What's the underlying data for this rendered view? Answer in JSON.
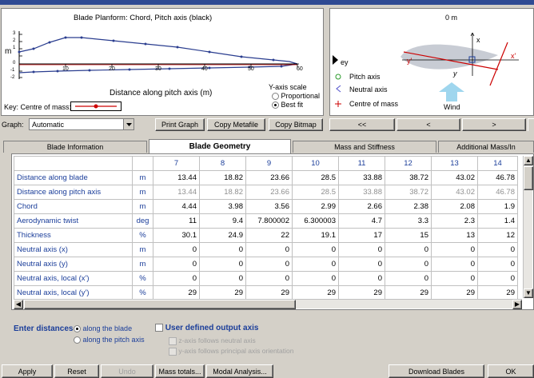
{
  "planform": {
    "title": "Blade Planform: Chord, Pitch axis (black)",
    "y_unit": "m",
    "x_label": "Distance along pitch axis (m)",
    "x_ticks": [
      "10",
      "20",
      "30",
      "40",
      "50",
      "60"
    ],
    "y_ticks": [
      "3",
      "2",
      "1",
      "0",
      "-1",
      "-2"
    ],
    "key_label": "Key:  Centre of mass:",
    "yscale_title": "Y-axis scale",
    "yscale_opt1": "Proportional",
    "yscale_opt2": "Best fit"
  },
  "section_view": {
    "top_label": "0 m",
    "ey_label": "ey",
    "pitch_axis": "Pitch axis",
    "neutral_axis": "Neutral axis",
    "centre_of_mass": "Centre of mass",
    "wind": "Wind",
    "x_label": "x",
    "y_label": "y",
    "xp_label": "x'",
    "yp_label": "y'"
  },
  "toolbar": {
    "graph_label": "Graph:",
    "graph_value": "Automatic",
    "print_graph": "Print Graph",
    "copy_metafile": "Copy Metafile",
    "copy_bitmap": "Copy Bitmap",
    "nav_first": "<<",
    "nav_prev": "<",
    "nav_next": ">"
  },
  "tabs": [
    "Blade Information",
    "Blade Geometry",
    "Mass and Stiffness",
    "Additional Mass/In"
  ],
  "table": {
    "columns": [
      "7",
      "8",
      "9",
      "10",
      "11",
      "12",
      "13",
      "14"
    ],
    "rows": [
      {
        "label": "Distance along blade",
        "unit": "m",
        "values": [
          "13.44",
          "18.82",
          "23.66",
          "28.5",
          "33.88",
          "38.72",
          "43.02",
          "46.78"
        ],
        "grey": false
      },
      {
        "label": "Distance along pitch axis",
        "unit": "m",
        "values": [
          "13.44",
          "18.82",
          "23.66",
          "28.5",
          "33.88",
          "38.72",
          "43.02",
          "46.78"
        ],
        "grey": true
      },
      {
        "label": "Chord",
        "unit": "m",
        "values": [
          "4.44",
          "3.98",
          "3.56",
          "2.99",
          "2.66",
          "2.38",
          "2.08",
          "1.9"
        ],
        "grey": false
      },
      {
        "label": "Aerodynamic twist",
        "unit": "deg",
        "values": [
          "11",
          "9.4",
          "7.800002",
          "6.300003",
          "4.7",
          "3.3",
          "2.3",
          "1.4"
        ],
        "grey": false
      },
      {
        "label": "Thickness",
        "unit": "%",
        "values": [
          "30.1",
          "24.9",
          "22",
          "19.1",
          "17",
          "15",
          "13",
          "12"
        ],
        "grey": false
      },
      {
        "label": "Neutral axis (x)",
        "unit": "m",
        "values": [
          "0",
          "0",
          "0",
          "0",
          "0",
          "0",
          "0",
          "0"
        ],
        "grey": false
      },
      {
        "label": "Neutral axis (y)",
        "unit": "m",
        "values": [
          "0",
          "0",
          "0",
          "0",
          "0",
          "0",
          "0",
          "0"
        ],
        "grey": false
      },
      {
        "label": "Neutral axis, local (x')",
        "unit": "%",
        "values": [
          "0",
          "0",
          "0",
          "0",
          "0",
          "0",
          "0",
          "0"
        ],
        "grey": false
      },
      {
        "label": "Neutral axis, local (y')",
        "unit": "%",
        "values": [
          "29",
          "29",
          "29",
          "29",
          "29",
          "29",
          "29",
          "29"
        ],
        "grey": false
      }
    ]
  },
  "options": {
    "enter_distances": "Enter distances",
    "along_blade": "along the blade",
    "along_pitch": "along the pitch axis",
    "user_defined": "User defined output axis",
    "z_axis": "z-axis follows neutral axis",
    "y_axis": "y-axis follows principal axis orientation"
  },
  "bottom_buttons": {
    "apply": "Apply",
    "reset": "Reset",
    "undo": "Undo",
    "mass_totals": "Mass totals...",
    "modal": "Modal Analysis...",
    "download": "Download Blades",
    "ok": "OK"
  }
}
